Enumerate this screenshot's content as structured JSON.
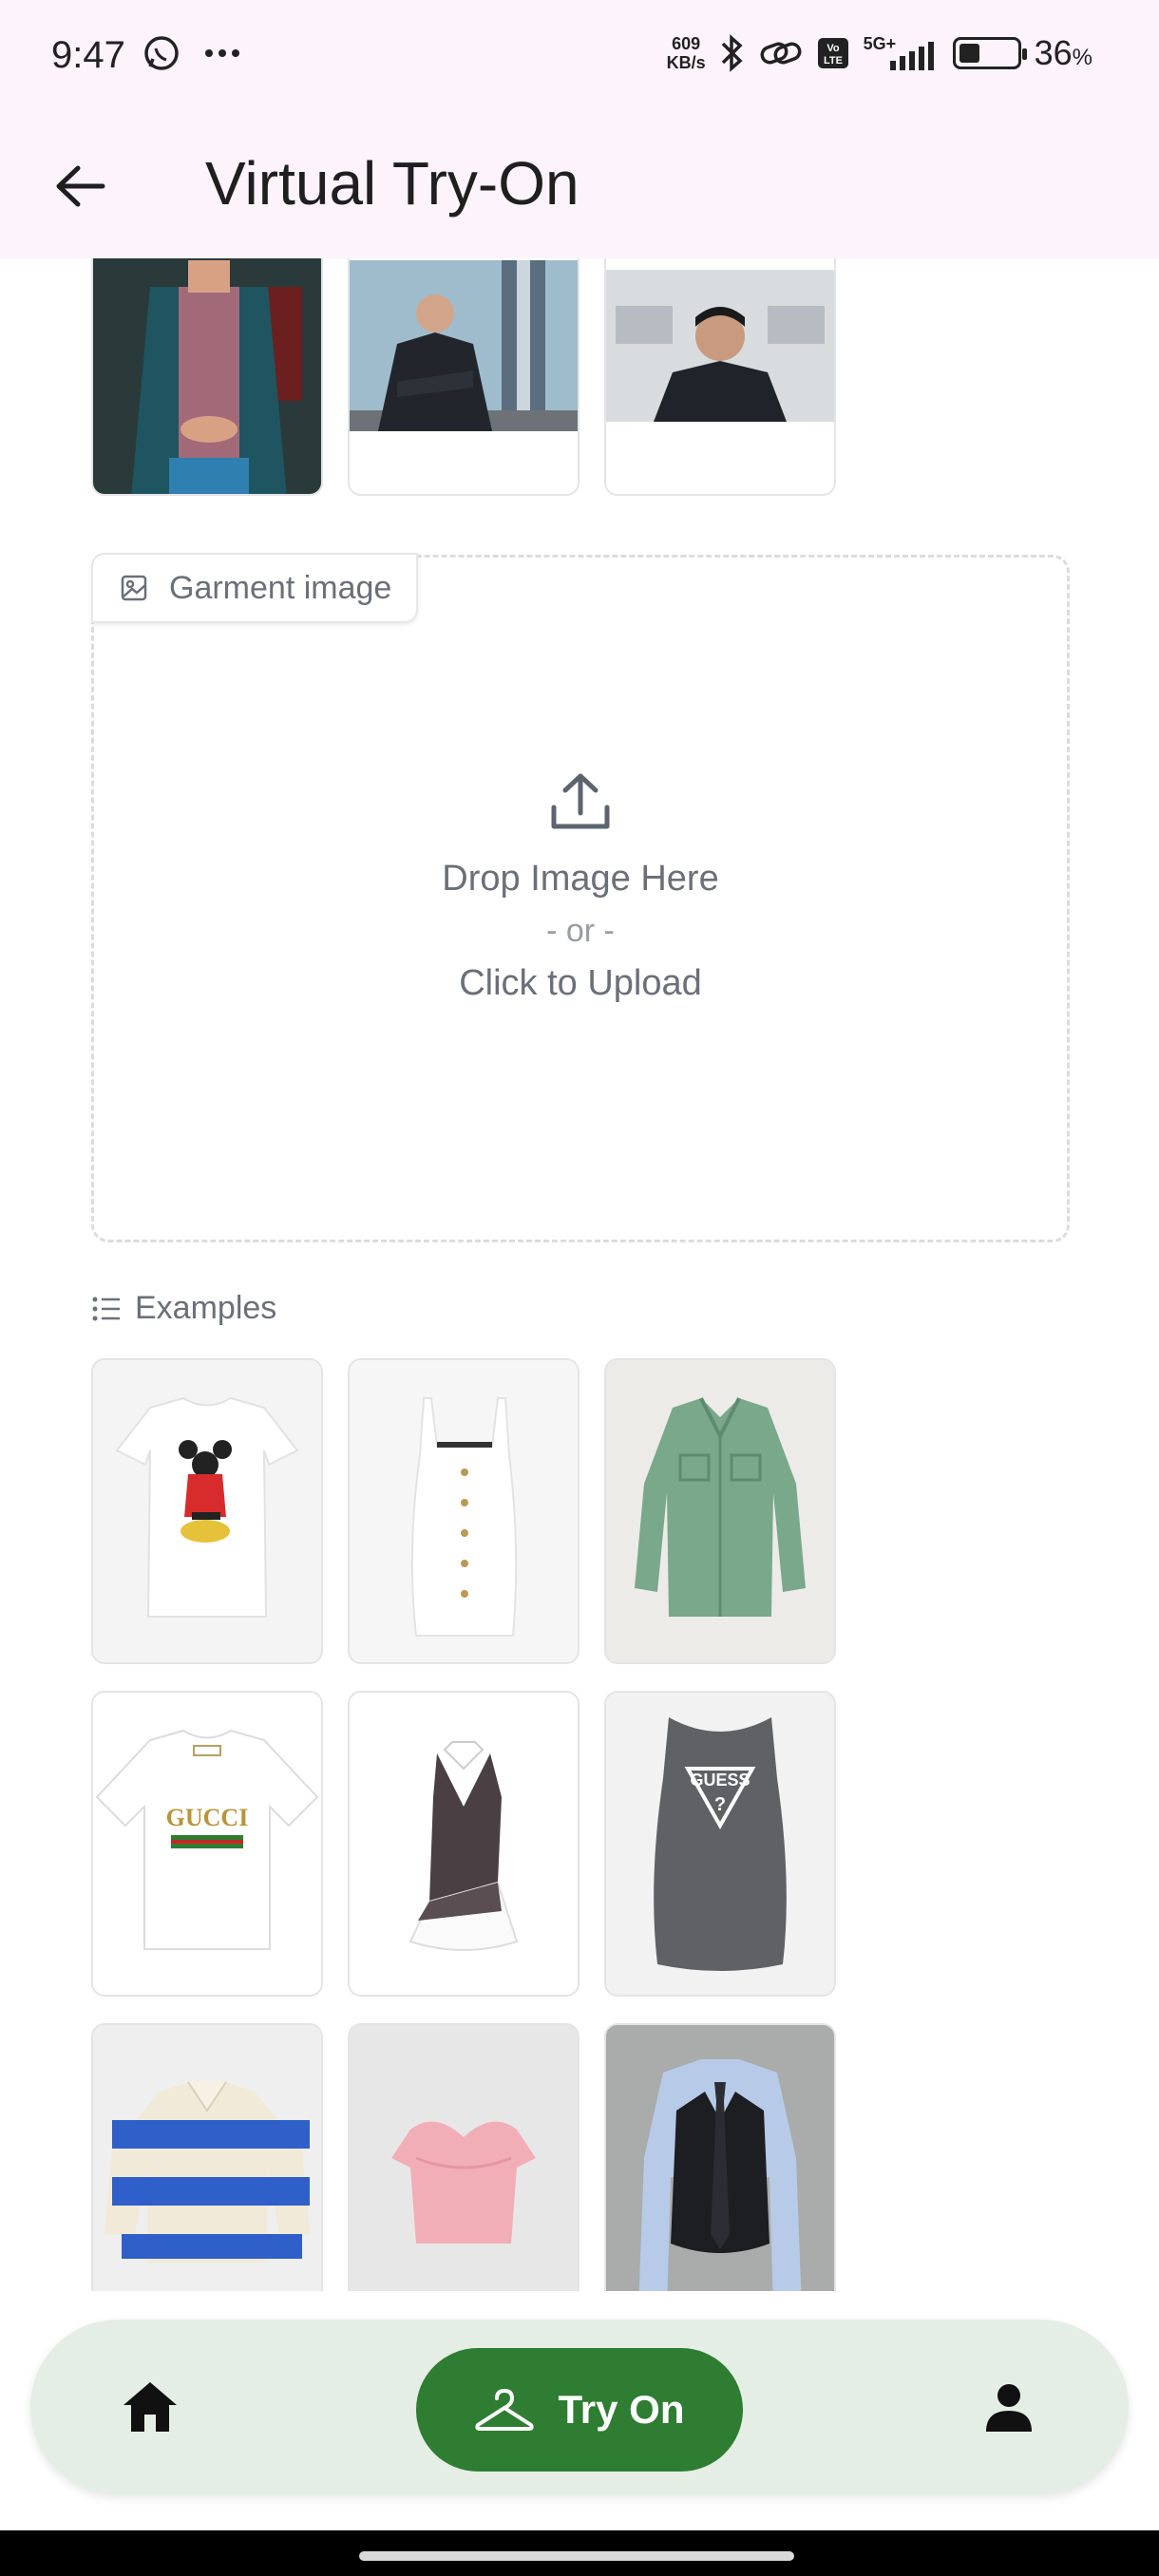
{
  "status_bar": {
    "time": "9:47",
    "net_speed_value": "609",
    "net_speed_unit": "KB/s",
    "network": "5G+",
    "battery_percent": "36",
    "battery_unit": "%",
    "battery_level": 0.36
  },
  "app_bar": {
    "title": "Virtual Try-On",
    "back_icon": "arrow-left-icon"
  },
  "person_examples": [
    {
      "name": "person-example-1",
      "description_icon": "photo"
    },
    {
      "name": "person-example-2",
      "description_icon": "photo"
    },
    {
      "name": "person-example-3",
      "description_icon": "photo"
    }
  ],
  "garment_upload": {
    "label": "Garment image",
    "drop_text": "Drop Image Here",
    "or_text": "- or -",
    "click_text": "Click to Upload",
    "icon": "upload-icon"
  },
  "examples": {
    "label": "Examples",
    "icon": "list-icon"
  },
  "bottom_nav": {
    "home_icon": "home-icon",
    "try_on_label": "Try On",
    "try_on_icon": "hanger-icon",
    "profile_icon": "person-icon"
  },
  "colors": {
    "app_bar_bg": "#fdf3fa",
    "nav_bg": "#e5eee4",
    "accent_green": "#2e7d32"
  }
}
